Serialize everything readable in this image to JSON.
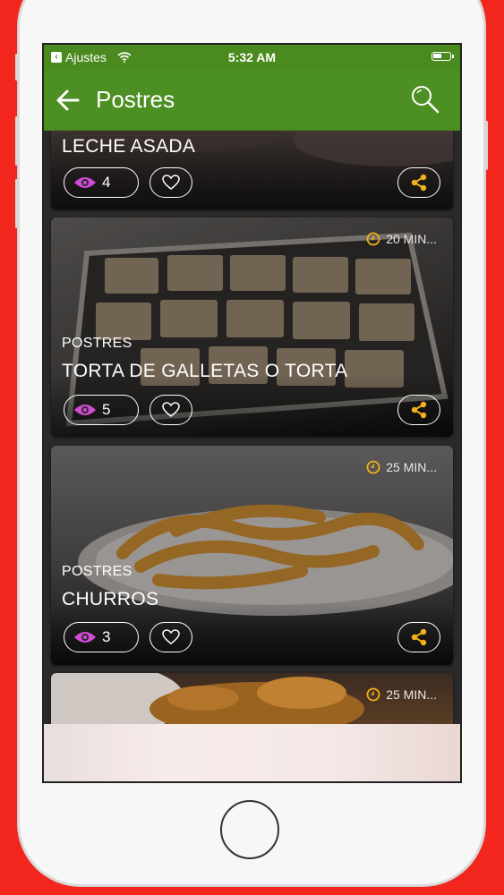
{
  "status_bar": {
    "back_app": "Ajustes",
    "time": "5:32 AM"
  },
  "app_bar": {
    "title": "Postres"
  },
  "cards": [
    {
      "category": "",
      "name": "LECHE ASADA",
      "views": "4",
      "time": ""
    },
    {
      "category": "POSTRES",
      "name": "TORTA DE GALLETAS O TORTA",
      "views": "5",
      "time": "20 MIN..."
    },
    {
      "category": "POSTRES",
      "name": "CHURROS",
      "views": "3",
      "time": "25 MIN..."
    },
    {
      "category": "",
      "name": "",
      "views": "",
      "time": "25 MIN..."
    }
  ],
  "colors": {
    "background": "#f3261d",
    "app_bar": "#4c8f22",
    "status_bar": "#4a8a1e",
    "view_icon": "#d24bd6",
    "share_icon": "#f2b21a",
    "clock_icon": "#f2b21a"
  },
  "icons": {
    "back": "arrow-left-icon",
    "search": "search-icon",
    "views": "eye-icon",
    "favorite": "heart-icon",
    "share": "share-icon",
    "time": "clock-icon"
  }
}
